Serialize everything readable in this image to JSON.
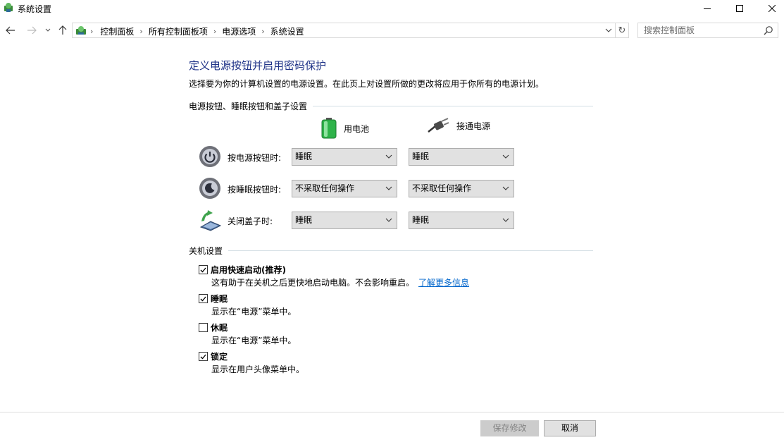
{
  "window": {
    "title": "系统设置"
  },
  "nav": {
    "breadcrumbs": [
      "控制面板",
      "所有控制面板项",
      "电源选项",
      "系统设置"
    ],
    "search_placeholder": "搜索控制面板"
  },
  "main": {
    "title": "定义电源按钮并启用密码保护",
    "subtitle": "选择要为你的计算机设置的电源设置。在此页上对设置所做的更改将应用于你所有的电源计划。",
    "power_group": {
      "heading": "电源按钮、睡眠按钮和盖子设置",
      "col_battery": "用电池",
      "col_plugged": "接通电源",
      "rows": [
        {
          "label": "按电源按钮时:",
          "battery": "睡眠",
          "plugged": "睡眠",
          "icon": "power-button-icon"
        },
        {
          "label": "按睡眠按钮时:",
          "battery": "不采取任何操作",
          "plugged": "不采取任何操作",
          "icon": "sleep-button-icon"
        },
        {
          "label": "关闭盖子时:",
          "battery": "睡眠",
          "plugged": "睡眠",
          "icon": "laptop-lid-icon"
        }
      ]
    },
    "shutdown_group": {
      "heading": "关机设置",
      "items": [
        {
          "label": "启用快速启动(推荐)",
          "desc": "这有助于在关机之后更快地启动电脑。不会影响重启。",
          "link": "了解更多信息",
          "checked": true
        },
        {
          "label": "睡眠",
          "desc": "显示在“电源”菜单中。",
          "checked": true
        },
        {
          "label": "休眠",
          "desc": "显示在“电源”菜单中。",
          "checked": false
        },
        {
          "label": "锁定",
          "desc": "显示在用户头像菜单中。",
          "checked": true
        }
      ]
    }
  },
  "footer": {
    "save_label": "保存修改",
    "cancel_label": "取消"
  },
  "colors": {
    "title_blue": "#1e3287",
    "link_blue": "#0066cc",
    "battery_green": "#2fb34a"
  }
}
